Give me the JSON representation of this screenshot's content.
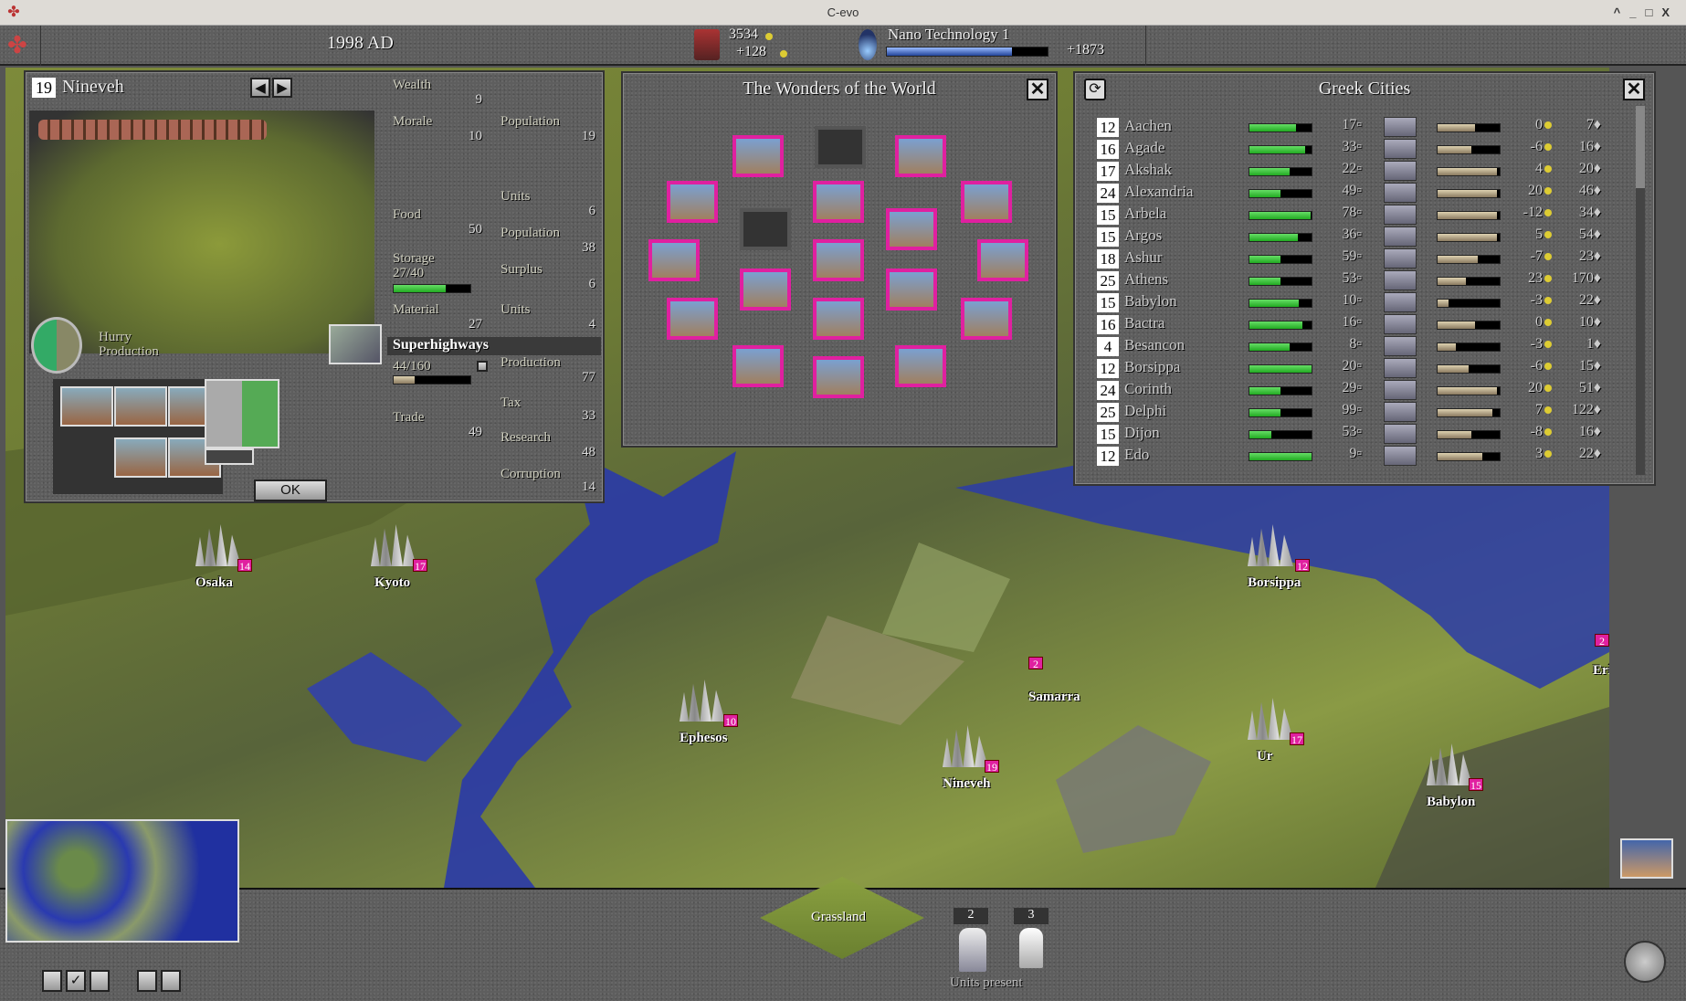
{
  "window": {
    "title": "C-evo"
  },
  "toolbar": {
    "year": "1998 AD",
    "treasury": "3534",
    "treasury_change": "+128",
    "research": "Nano Technology 1",
    "research_progress": 0.78,
    "research_points": "+1873"
  },
  "city": {
    "size": "19",
    "name": "Nineveh",
    "wealth": {
      "label": "Wealth",
      "value": "9"
    },
    "morale": {
      "label": "Morale",
      "value": "10"
    },
    "population": {
      "label": "Population",
      "value": "19"
    },
    "food": {
      "label": "Food",
      "value": "50"
    },
    "food_units": {
      "label": "Units",
      "value": "6"
    },
    "food_population": {
      "label": "Population",
      "value": "38"
    },
    "storage": {
      "label": "Storage",
      "value": "27/40",
      "fraction": 0.675
    },
    "surplus": {
      "label": "Surplus",
      "value": "6"
    },
    "material": {
      "label": "Material",
      "value": "27"
    },
    "material_units": {
      "label": "Units",
      "value": "4"
    },
    "project": "Superhighways",
    "project_progress": "44/160",
    "production": {
      "label": "Production",
      "value": "77"
    },
    "trade": {
      "label": "Trade",
      "value": "49"
    },
    "tax": {
      "label": "Tax",
      "value": "33"
    },
    "research": {
      "label": "Research",
      "value": "48"
    },
    "corruption": {
      "label": "Corruption",
      "value": "14"
    },
    "hurry": "Hurry",
    "hurry2": "Production",
    "ok": "OK"
  },
  "wonders": {
    "title": "The Wonders of the World"
  },
  "greek_cities": {
    "title": "Greek Cities",
    "rows": [
      {
        "size": "12",
        "name": "Aachen",
        "food": 0.75,
        "storage": "17",
        "icon": "recycling-center",
        "prod": 0.6,
        "gold": "0",
        "science": "7"
      },
      {
        "size": "16",
        "name": "Agade",
        "food": 0.9,
        "storage": "33",
        "icon": "research-lab",
        "prod": 0.55,
        "gold": "-6",
        "science": "16"
      },
      {
        "size": "17",
        "name": "Akshak",
        "food": 0.65,
        "storage": "22",
        "icon": "courthouse",
        "prod": 0.95,
        "gold": "4",
        "science": "20"
      },
      {
        "size": "24",
        "name": "Alexandria",
        "food": 0.5,
        "storage": "49",
        "icon": "jet-fighter",
        "prod": 0.95,
        "gold": "20",
        "science": "46"
      },
      {
        "size": "15",
        "name": "Arbela",
        "food": 0.98,
        "storage": "78",
        "icon": "offshore-platform",
        "prod": 0.95,
        "gold": "-12",
        "science": "34"
      },
      {
        "size": "15",
        "name": "Argos",
        "food": 0.78,
        "storage": "36",
        "icon": "offshore-platform",
        "prod": 0.95,
        "gold": "5",
        "science": "54"
      },
      {
        "size": "18",
        "name": "Ashur",
        "food": 0.5,
        "storage": "59",
        "icon": "jet-fighter",
        "prod": 0.65,
        "gold": "-7",
        "science": "23"
      },
      {
        "size": "25",
        "name": "Athens",
        "food": 0.5,
        "storage": "53",
        "icon": "jet-fighter",
        "prod": 0.45,
        "gold": "23",
        "science": "170"
      },
      {
        "size": "15",
        "name": "Babylon",
        "food": 0.8,
        "storage": "10",
        "icon": "offshore-platform",
        "prod": 0.18,
        "gold": "-3",
        "science": "22"
      },
      {
        "size": "16",
        "name": "Bactra",
        "food": 0.85,
        "storage": "16",
        "icon": "recycling-center",
        "prod": 0.6,
        "gold": "0",
        "science": "10"
      },
      {
        "size": "4",
        "name": "Besancon",
        "food": 0.65,
        "storage": "8",
        "icon": "temple",
        "prod": 0.3,
        "gold": "-3",
        "science": "1"
      },
      {
        "size": "12",
        "name": "Borsippa",
        "food": 1.0,
        "storage": "20",
        "icon": "mass-transit",
        "prod": 0.5,
        "gold": "-6",
        "science": "15"
      },
      {
        "size": "24",
        "name": "Corinth",
        "food": 0.5,
        "storage": "29",
        "icon": "jet-fighter",
        "prod": 0.95,
        "gold": "20",
        "science": "51"
      },
      {
        "size": "25",
        "name": "Delphi",
        "food": 0.5,
        "storage": "99",
        "icon": "jet-fighter",
        "prod": 0.88,
        "gold": "7",
        "science": "122"
      },
      {
        "size": "15",
        "name": "Dijon",
        "food": 0.35,
        "storage": "53",
        "icon": "cathedral",
        "prod": 0.55,
        "gold": "-8",
        "science": "16"
      },
      {
        "size": "12",
        "name": "Edo",
        "food": 1.0,
        "storage": "9",
        "icon": "mass-transit",
        "prod": 0.72,
        "gold": "3",
        "science": "22"
      }
    ]
  },
  "map_cities": [
    {
      "name": "Osaka",
      "size": "14"
    },
    {
      "name": "Kyoto",
      "size": "17"
    },
    {
      "name": "Borsippa",
      "size": "12"
    },
    {
      "name": "Eridu",
      "size": "2"
    },
    {
      "name": "Samarra",
      "size": "2"
    },
    {
      "name": "Ephesos",
      "size": "10"
    },
    {
      "name": "Nineveh",
      "size": "19"
    },
    {
      "name": "Ur",
      "size": "17"
    },
    {
      "name": "Babylon",
      "size": "15"
    }
  ],
  "bottom": {
    "terrain": "Grassland",
    "units_label": "Units present",
    "unit_counts": [
      "2",
      "3"
    ]
  }
}
